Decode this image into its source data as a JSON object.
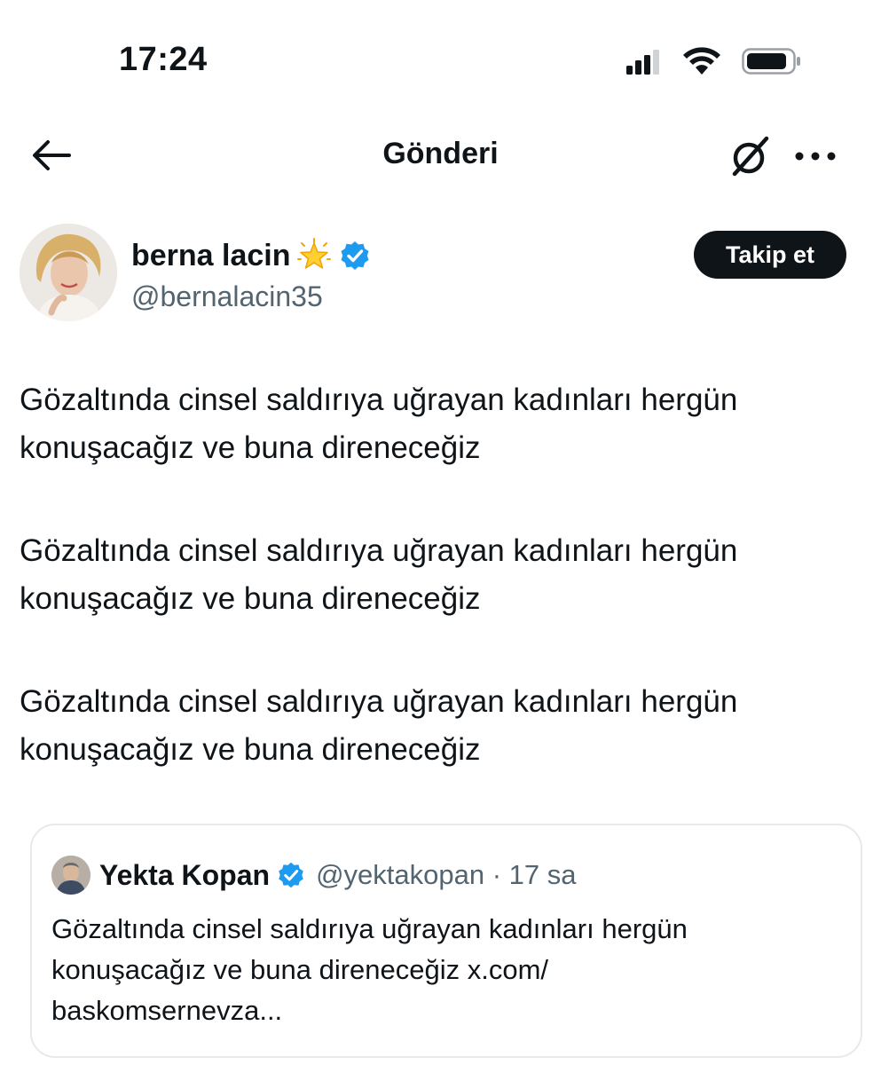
{
  "status_bar": {
    "time": "17:24",
    "icons": [
      "signal-icon",
      "wifi-icon",
      "battery-icon"
    ]
  },
  "nav": {
    "title": "Gönderi",
    "icons": [
      "back-arrow-icon",
      "grok-icon",
      "more-icon"
    ]
  },
  "author": {
    "name": "berna lacin",
    "handle": "@bernalacin35",
    "follow_label": "Takip et",
    "badges": [
      "star-emoji-icon",
      "verified-badge-icon"
    ]
  },
  "tweet": {
    "paragraphs": [
      "Gözaltında cinsel saldırıya uğrayan kadınları hergün konuşacağız ve buna direneceğiz",
      "Gözaltında cinsel saldırıya uğrayan kadınları hergün konuşacağız ve buna direneceğiz",
      "Gözaltında cinsel saldırıya uğrayan kadınları hergün konuşacağız ve buna direneceğiz"
    ]
  },
  "quote": {
    "name": "Yekta Kopan",
    "handle": "@yektakopan",
    "separator": "·",
    "time": "17 sa",
    "text": "Gözaltında cinsel saldırıya uğrayan kadınları hergün konuşacağız ve buna direneceğiz x.com/\nbaskomsernevza..."
  },
  "colors": {
    "text_primary": "#0f1419",
    "text_secondary": "#536471",
    "verified_blue": "#1d9bf0",
    "border": "#e7e9ea",
    "button_bg": "#0f1419"
  }
}
